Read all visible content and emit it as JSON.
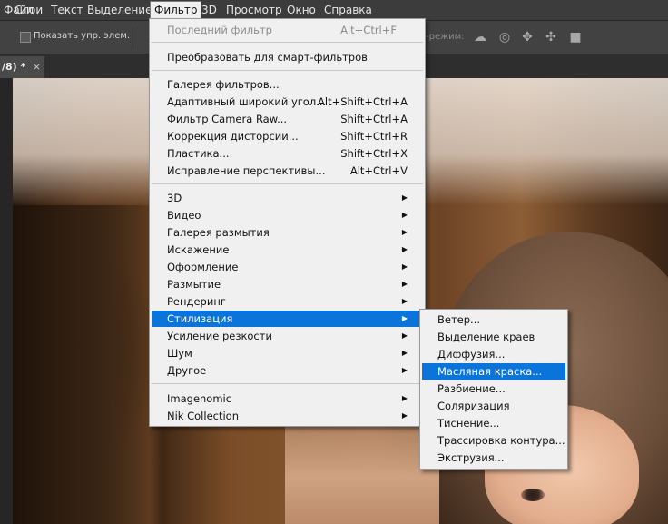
{
  "menubar": {
    "items": [
      "Фильтр"
    ]
  },
  "menubar_items": [
    {
      "label": "Файл"
    },
    {
      "label": "Слои"
    },
    {
      "label": "Текст"
    },
    {
      "label": "Выделение"
    },
    {
      "label": "Фильтр",
      "active": true
    },
    {
      "label": "3D"
    },
    {
      "label": "Просмотр"
    },
    {
      "label": "Окно"
    },
    {
      "label": "Справка"
    }
  ],
  "options_bar": {
    "show_controls_label": "Показать упр. элем.",
    "mode_label": "-режим:"
  },
  "tab": {
    "title": "/8) *",
    "close": "×"
  },
  "filter_menu": {
    "last_filter": {
      "label": "Последний фильтр",
      "shortcut": "Alt+Ctrl+F"
    },
    "convert_smart": {
      "label": "Преобразовать для смарт-фильтров"
    },
    "group1": [
      {
        "label": "Галерея фильтров...",
        "shortcut": ""
      },
      {
        "label": "Адаптивный широкий угол...",
        "shortcut": "Alt+Shift+Ctrl+A"
      },
      {
        "label": "Фильтр Camera Raw...",
        "shortcut": "Shift+Ctrl+A"
      },
      {
        "label": "Коррекция дисторсии...",
        "shortcut": "Shift+Ctrl+R"
      },
      {
        "label": "Пластика...",
        "shortcut": "Shift+Ctrl+X"
      },
      {
        "label": "Исправление перспективы...",
        "shortcut": "Alt+Ctrl+V"
      }
    ],
    "group2": [
      {
        "label": "3D"
      },
      {
        "label": "Видео"
      },
      {
        "label": "Галерея размытия"
      },
      {
        "label": "Искажение"
      },
      {
        "label": "Оформление"
      },
      {
        "label": "Размытие"
      },
      {
        "label": "Рендеринг"
      },
      {
        "label": "Стилизация",
        "highlighted": true
      },
      {
        "label": "Усиление резкости"
      },
      {
        "label": "Шум"
      },
      {
        "label": "Другое"
      }
    ],
    "group3": [
      {
        "label": "Imagenomic"
      },
      {
        "label": "Nik Collection"
      }
    ]
  },
  "stylize_menu": {
    "items": [
      {
        "label": "Ветер..."
      },
      {
        "label": "Выделение краев"
      },
      {
        "label": "Диффузия..."
      },
      {
        "label": "Масляная краска...",
        "highlighted": true
      },
      {
        "label": "Разбиение..."
      },
      {
        "label": "Соляризация"
      },
      {
        "label": "Тиснение..."
      },
      {
        "label": "Трассировка контура..."
      },
      {
        "label": "Экструзия..."
      }
    ]
  },
  "colors": {
    "highlight": "#0a74da",
    "menu_bg": "#f0f0f0",
    "menubar_bg": "#3c3c3c"
  }
}
